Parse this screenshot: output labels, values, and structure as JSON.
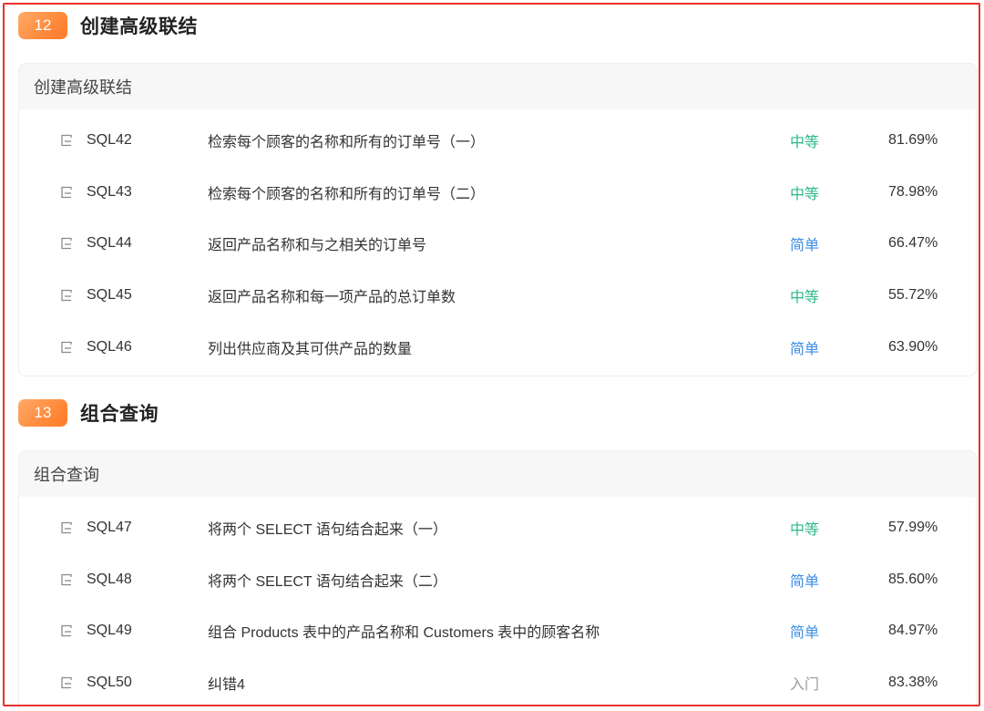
{
  "sections": [
    {
      "number": "12",
      "title": "创建高级联结",
      "card_title": "创建高级联结",
      "problems": [
        {
          "id": "SQL42",
          "title": "检索每个顾客的名称和所有的订单号（一）",
          "level": "中等",
          "rate": "81.69%"
        },
        {
          "id": "SQL43",
          "title": "检索每个顾客的名称和所有的订单号（二）",
          "level": "中等",
          "rate": "78.98%"
        },
        {
          "id": "SQL44",
          "title": "返回产品名称和与之相关的订单号",
          "level": "简单",
          "rate": "66.47%"
        },
        {
          "id": "SQL45",
          "title": "返回产品名称和每一项产品的总订单数",
          "level": "中等",
          "rate": "55.72%"
        },
        {
          "id": "SQL46",
          "title": "列出供应商及其可供产品的数量",
          "level": "简单",
          "rate": "63.90%"
        }
      ]
    },
    {
      "number": "13",
      "title": "组合查询",
      "card_title": "组合查询",
      "problems": [
        {
          "id": "SQL47",
          "title": "将两个 SELECT 语句结合起来（一）",
          "level": "中等",
          "rate": "57.99%"
        },
        {
          "id": "SQL48",
          "title": "将两个 SELECT 语句结合起来（二）",
          "level": "简单",
          "rate": "85.60%"
        },
        {
          "id": "SQL49",
          "title": "组合 Products 表中的产品名称和 Customers 表中的顾客名称",
          "level": "简单",
          "rate": "84.97%"
        },
        {
          "id": "SQL50",
          "title": "纠错4",
          "level": "入门",
          "rate": "83.38%"
        }
      ]
    }
  ],
  "level_colors": {
    "中等": "#2db888",
    "简单": "#3a8ee6",
    "入门": "#9a9a9a"
  },
  "icons": {
    "problem": "document-icon"
  },
  "highlight_color": "#e8322c"
}
